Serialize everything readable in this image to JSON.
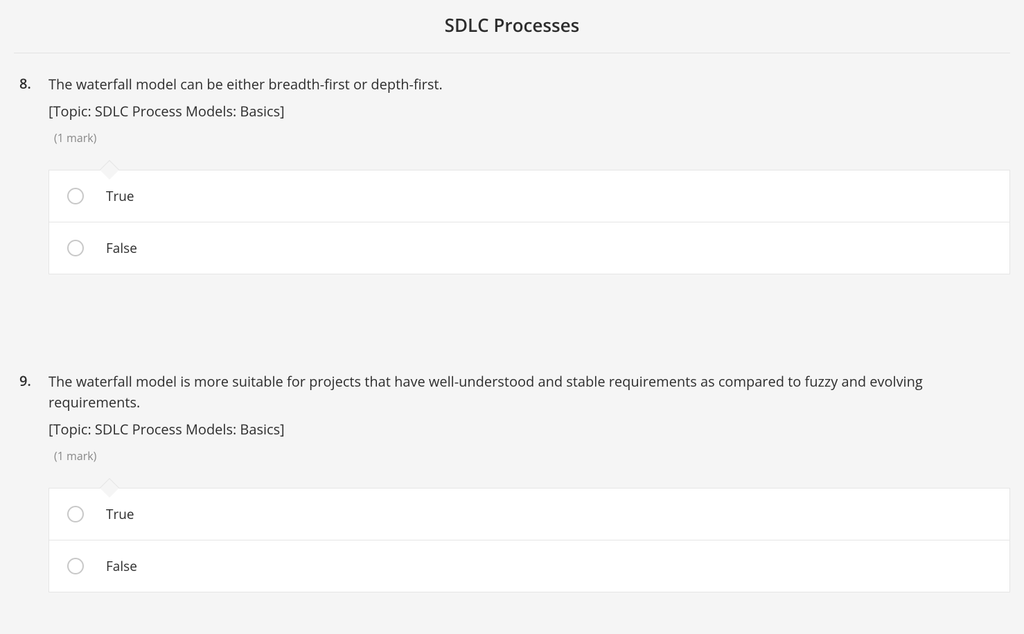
{
  "header": {
    "title": "SDLC Processes"
  },
  "questions": [
    {
      "number": "8.",
      "text": "The waterfall model can be either breadth-first or depth-first.",
      "topic": "[Topic: SDLC Process Models: Basics]",
      "marks": "(1 mark)",
      "options": [
        {
          "label": "True"
        },
        {
          "label": "False"
        }
      ]
    },
    {
      "number": "9.",
      "text": "The waterfall model is more suitable for projects that have well-understood and stable requirements as compared to fuzzy and evolving requirements.",
      "topic": "[Topic: SDLC Process Models: Basics]",
      "marks": "(1 mark)",
      "options": [
        {
          "label": "True"
        },
        {
          "label": "False"
        }
      ]
    }
  ]
}
